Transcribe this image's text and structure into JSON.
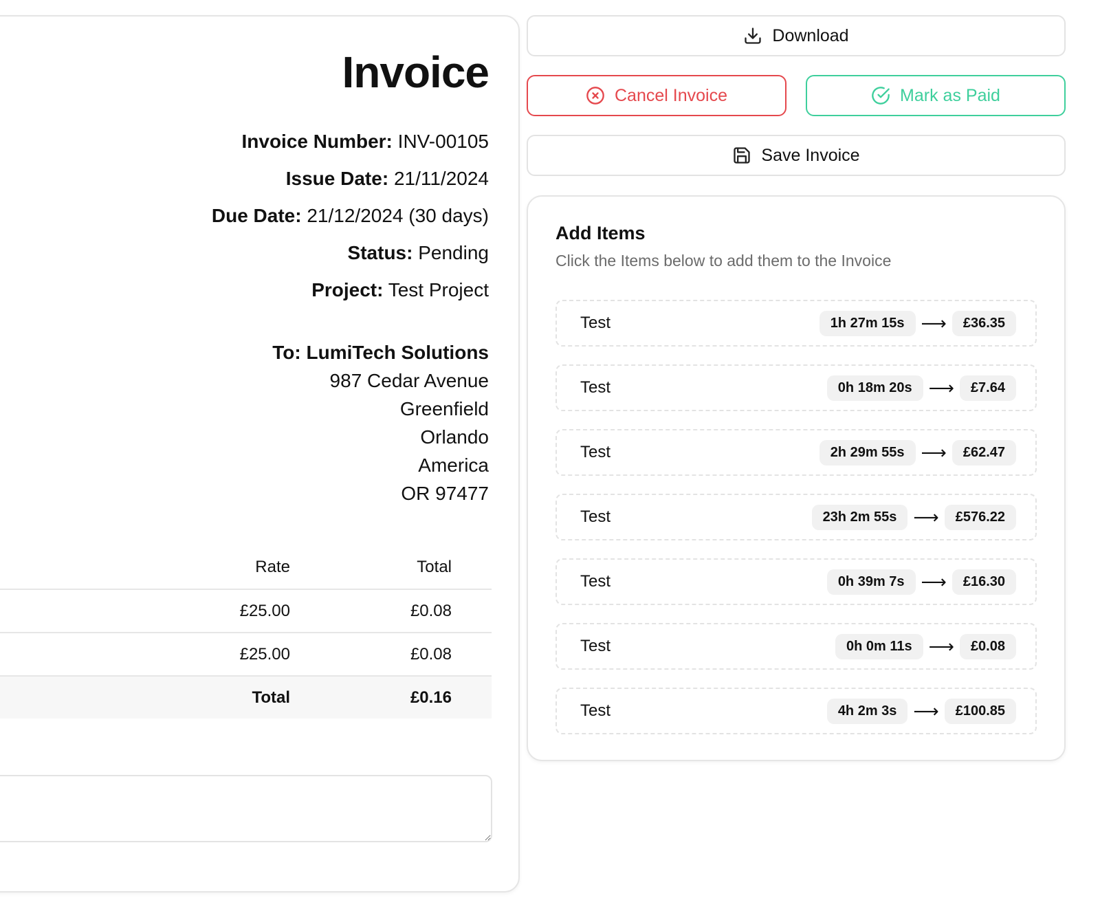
{
  "invoice": {
    "title": "Invoice",
    "number_label": "Invoice Number:",
    "number": "INV-00105",
    "issue_label": "Issue Date:",
    "issue_date": "21/11/2024",
    "due_label": "Due Date:",
    "due_date": "21/12/2024 (30 days)",
    "status_label": "Status:",
    "status": "Pending",
    "project_label": "Project:",
    "project": "Test Project",
    "to": "To: LumiTech Solutions",
    "address": [
      "987 Cedar Avenue",
      "Greenfield",
      "Orlando",
      "America",
      "OR 97477"
    ],
    "table": {
      "headers": {
        "rate": "Rate",
        "total": "Total"
      },
      "rows": [
        {
          "rate": "£25.00",
          "total": "£0.08"
        },
        {
          "rate": "£25.00",
          "total": "£0.08"
        }
      ],
      "total_label": "Total",
      "total_value": "£0.16"
    },
    "notes_value": ""
  },
  "actions": {
    "download": "Download",
    "cancel": "Cancel Invoice",
    "mark_paid": "Mark as Paid",
    "save": "Save Invoice"
  },
  "colors": {
    "cancel": "#e5484d",
    "paid": "#3ecf9c"
  },
  "add_items": {
    "title": "Add Items",
    "subtitle": "Click the Items below to add them to the Invoice",
    "items": [
      {
        "name": "Test",
        "duration": "1h 27m 15s",
        "amount": "£36.35"
      },
      {
        "name": "Test",
        "duration": "0h 18m 20s",
        "amount": "£7.64"
      },
      {
        "name": "Test",
        "duration": "2h 29m 55s",
        "amount": "£62.47"
      },
      {
        "name": "Test",
        "duration": "23h 2m 55s",
        "amount": "£576.22"
      },
      {
        "name": "Test",
        "duration": "0h 39m 7s",
        "amount": "£16.30"
      },
      {
        "name": "Test",
        "duration": "0h 0m 11s",
        "amount": "£0.08"
      },
      {
        "name": "Test",
        "duration": "4h 2m 3s",
        "amount": "£100.85"
      }
    ]
  }
}
